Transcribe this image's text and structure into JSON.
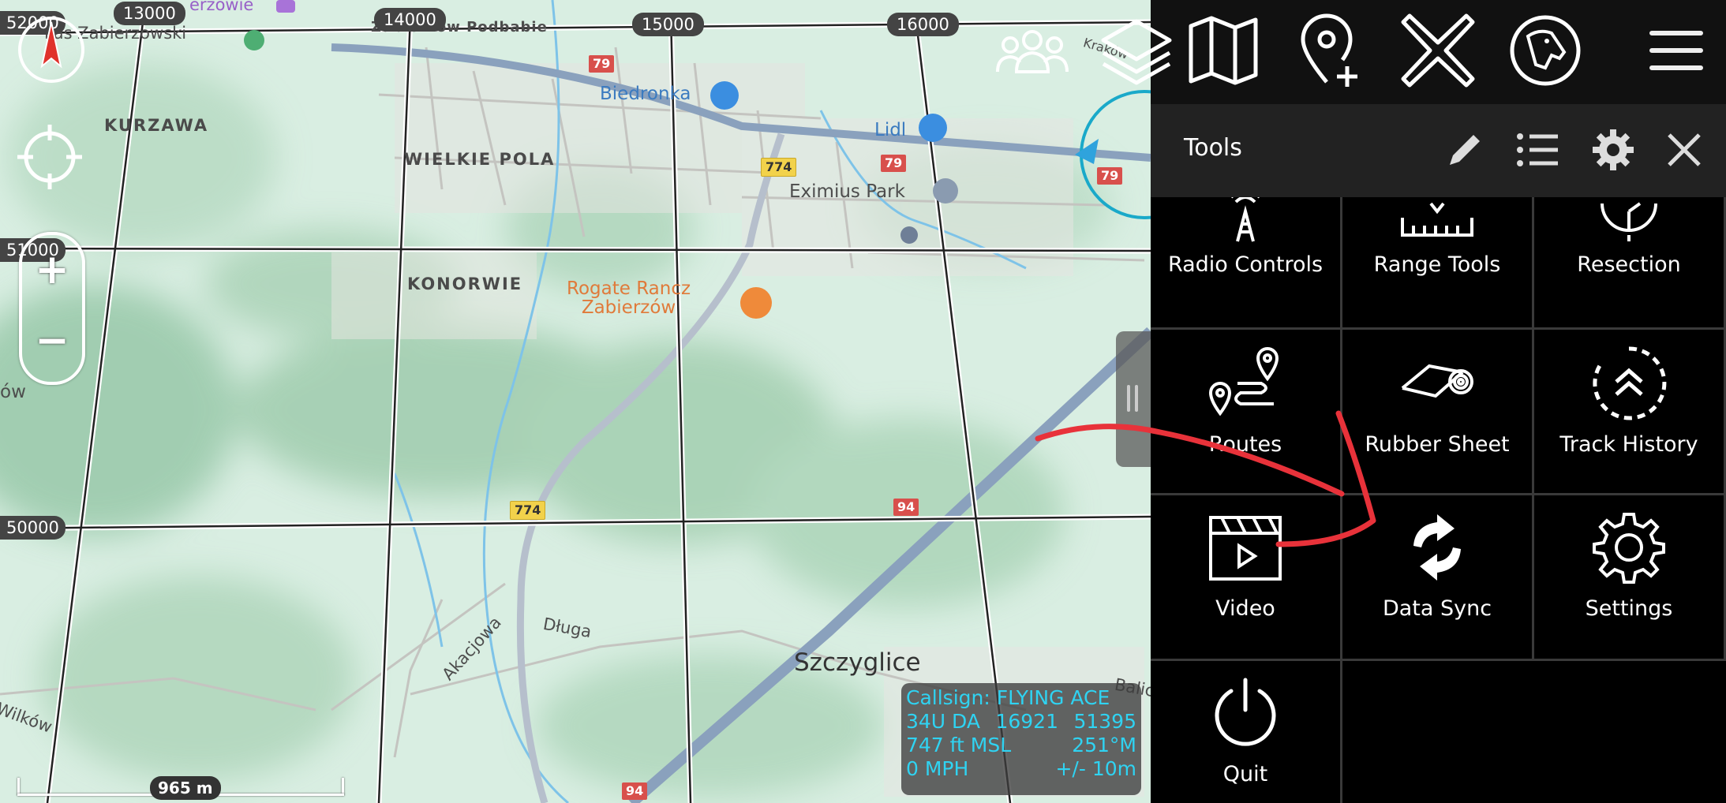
{
  "map": {
    "eastings": [
      "13000",
      "14000",
      "15000",
      "16000"
    ],
    "northings": [
      "52000",
      "51000",
      "50000"
    ],
    "places": {
      "kurzawa": "KURZAWA",
      "wielkie_pola": "WIELKIE POLA",
      "konorwie": "KONORWIE",
      "szczyglice": "Szczyglice",
      "las_zabierzowski": "Las Zabierzowski",
      "zabierzowie": "erzowie",
      "zabierzow_podgorny": "Zabierzów Podbabie"
    },
    "pois": {
      "biedronka": "Biedronka",
      "lidl": "Lidl",
      "eximius": "Eximius Park",
      "rogate": "Rogate Rancz\nZabierzów"
    },
    "streets": {
      "akacjowa": "Akacjowa",
      "dluga": "Długa",
      "wilkow": "Wilków",
      "balicka": "Balicka",
      "krakow": "Kraków",
      "ow": "ów"
    },
    "road_numbers": {
      "r79a": "79",
      "r79b": "79",
      "r79c": "79",
      "r774a": "774",
      "r774b": "774",
      "r94a": "94",
      "r94b": "94"
    },
    "zoom_in": "+",
    "zoom_out": "−",
    "scale_label": "965 m"
  },
  "info": {
    "callsign": "Callsign: FLYING ACE",
    "grid_zone": "34U  DA",
    "easting": "16921",
    "northing": "51395",
    "altitude": "747 ft MSL",
    "heading": "251°M",
    "speed": "0 MPH",
    "accuracy": "+/- 10m"
  },
  "toolbar": {
    "icons": [
      "team-icon",
      "layers-icon",
      "map-icon",
      "add-point-icon",
      "close-x-icon",
      "dog-app-icon",
      "hamburger-menu-icon"
    ]
  },
  "tools_panel": {
    "title": "Tools",
    "items": [
      {
        "label": "Radio Controls",
        "icon": "radio-tower-icon"
      },
      {
        "label": "Range Tools",
        "icon": "ruler-icon"
      },
      {
        "label": "Resection",
        "icon": "resection-icon"
      },
      {
        "label": "Routes",
        "icon": "routes-icon"
      },
      {
        "label": "Rubber Sheet",
        "icon": "rubber-sheet-icon"
      },
      {
        "label": "Track History",
        "icon": "track-history-icon"
      },
      {
        "label": "Video",
        "icon": "video-clapper-icon"
      },
      {
        "label": "Data Sync",
        "icon": "sync-icon"
      },
      {
        "label": "Settings",
        "icon": "gear-icon"
      },
      {
        "label": "Quit",
        "icon": "power-icon"
      }
    ]
  },
  "colors": {
    "map_base": "#d6ecdf",
    "panel_bg": "#000000",
    "topbar_bg": "#111111",
    "info_text": "#2fd3f2",
    "annotation": "#e8323a"
  }
}
